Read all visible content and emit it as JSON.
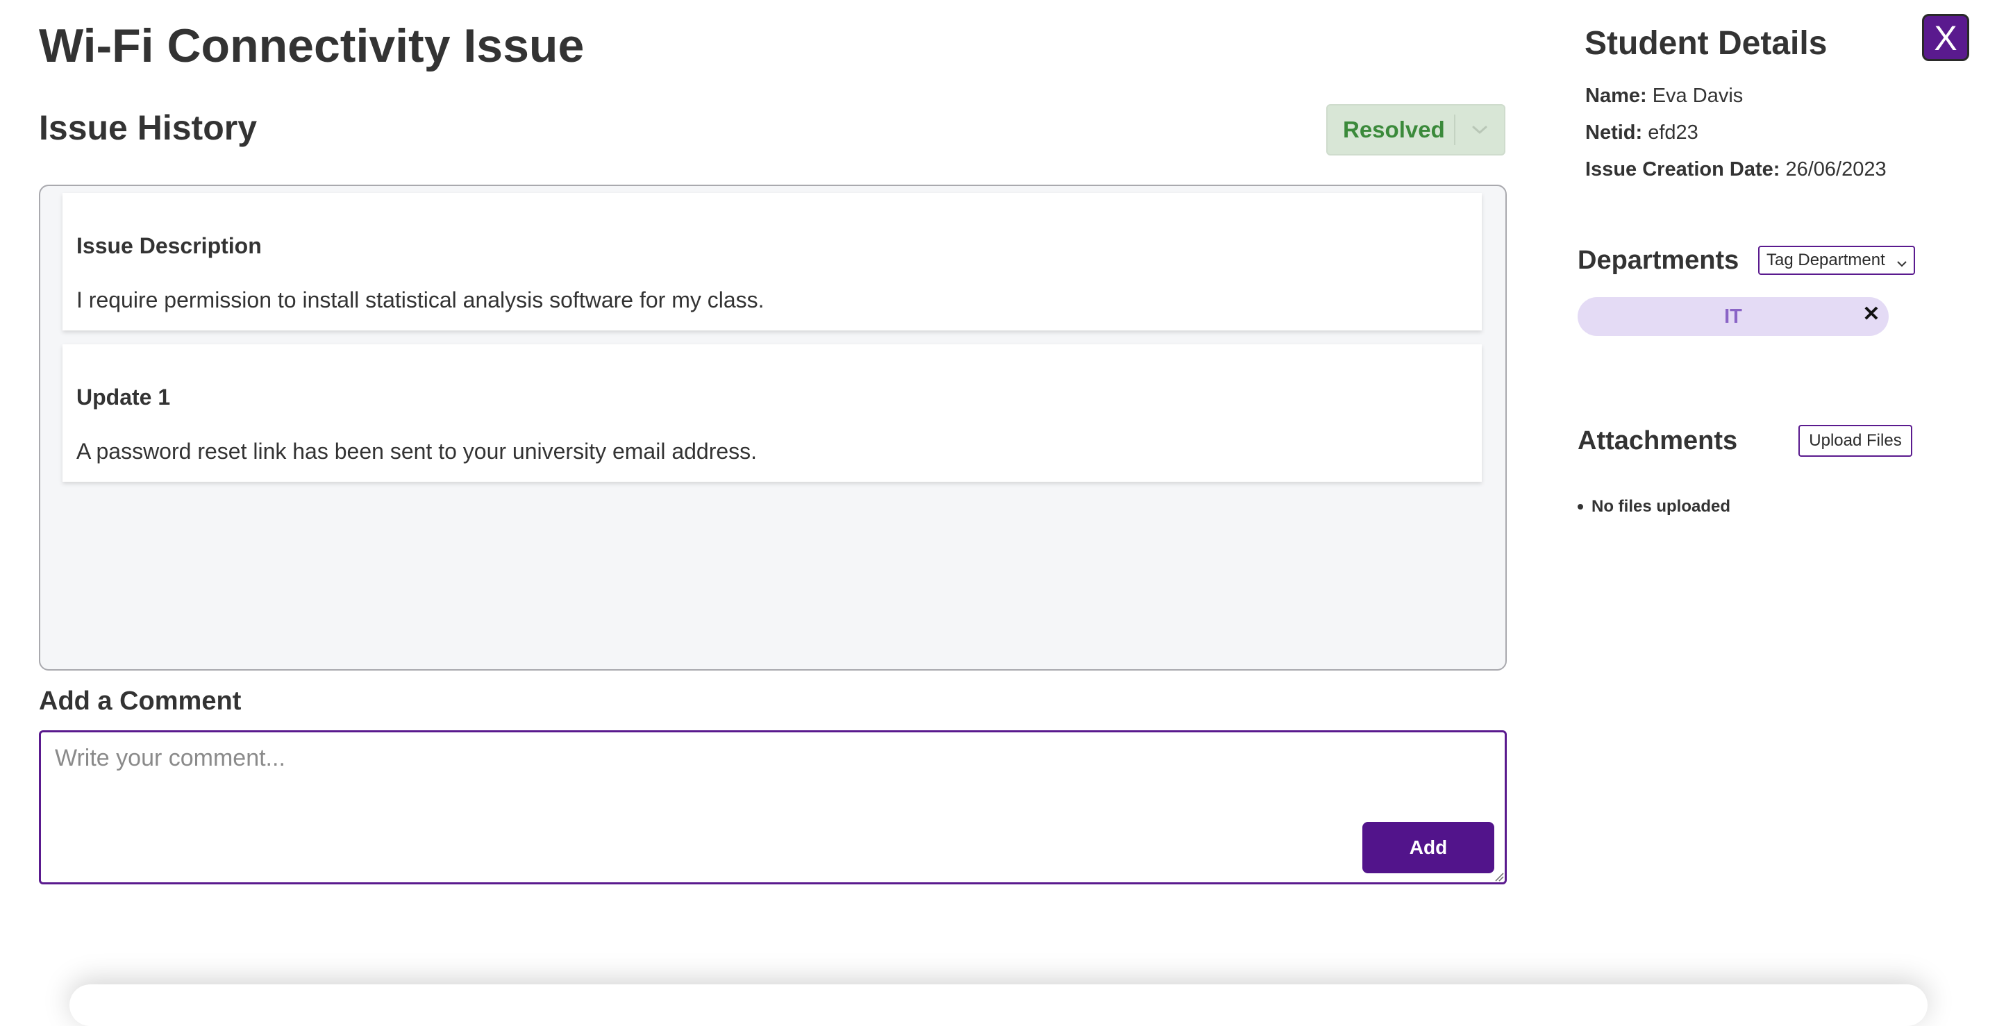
{
  "issue": {
    "title": "Wi-Fi Connectivity Issue"
  },
  "history": {
    "heading": "Issue History",
    "status": "Resolved",
    "entries": [
      {
        "title": "Issue Description",
        "body": "I require permission to install statistical analysis software for my class."
      },
      {
        "title": "Update 1",
        "body": "A password reset link has been sent to your university email address."
      }
    ]
  },
  "comment": {
    "heading": "Add a Comment",
    "placeholder": "Write your comment...",
    "add_label": "Add"
  },
  "close_label": "X",
  "student": {
    "heading": "Student Details",
    "name_label": "Name:",
    "name_value": "Eva Davis",
    "netid_label": "Netid:",
    "netid_value": "efd23",
    "date_label": "Issue Creation Date:",
    "date_value": "26/06/2023"
  },
  "departments": {
    "heading": "Departments",
    "select_label": "Tag Department",
    "tags": [
      {
        "label": "IT",
        "remove": "✕"
      }
    ]
  },
  "attachments": {
    "heading": "Attachments",
    "upload_label": "Upload Files",
    "empty_text": "No files uploaded"
  },
  "colors": {
    "accent": "#52148b",
    "status_bg": "#d8e6d6",
    "status_text": "#3b8a3b",
    "chip_bg": "#e4dbf5",
    "chip_text": "#8a64c6"
  },
  "icons": {
    "status_chevron": "chevron-down-icon",
    "select_chevron": "chevron-down-icon",
    "tag_remove": "close-icon",
    "resize": "resize-grip-icon"
  }
}
